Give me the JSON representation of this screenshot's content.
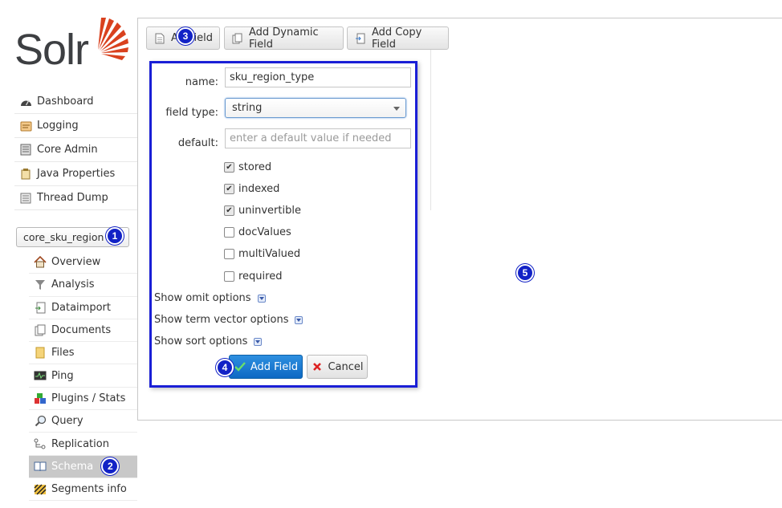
{
  "app": {
    "logo_text": "Solr",
    "brand_color": "#d9411e",
    "annotation_color": "#1222c6"
  },
  "sidebar": {
    "items": [
      {
        "label": "Dashboard",
        "icon": "dashboard-icon"
      },
      {
        "label": "Logging",
        "icon": "logging-icon"
      },
      {
        "label": "Core Admin",
        "icon": "core-admin-icon"
      },
      {
        "label": "Java Properties",
        "icon": "java-properties-icon"
      },
      {
        "label": "Thread Dump",
        "icon": "thread-dump-icon"
      }
    ],
    "core_selector": {
      "value": "core_sku_region",
      "badge": "1"
    },
    "core_items": [
      {
        "label": "Overview",
        "icon": "home-icon"
      },
      {
        "label": "Analysis",
        "icon": "funnel-icon"
      },
      {
        "label": "Dataimport",
        "icon": "import-icon"
      },
      {
        "label": "Documents",
        "icon": "documents-icon"
      },
      {
        "label": "Files",
        "icon": "folder-icon"
      },
      {
        "label": "Ping",
        "icon": "ping-icon"
      },
      {
        "label": "Plugins / Stats",
        "icon": "plugins-icon"
      },
      {
        "label": "Query",
        "icon": "magnifier-icon"
      },
      {
        "label": "Replication",
        "icon": "replication-icon"
      },
      {
        "label": "Schema",
        "icon": "book-icon",
        "active": true,
        "badge": "2"
      },
      {
        "label": "Segments info",
        "icon": "segments-icon"
      }
    ]
  },
  "toolbar": {
    "add_field": {
      "label": "Add Field",
      "label_visible_prefix": "A",
      "label_visible_suffix": "ield",
      "badge": "3"
    },
    "add_dynamic_field": "Add Dynamic Field",
    "add_copy_field": "Add Copy Field"
  },
  "form": {
    "name_label": "name:",
    "name_value": "sku_region_type",
    "field_type_label": "field type:",
    "field_type_value": "string",
    "default_label": "default:",
    "default_placeholder": "enter a default value if needed",
    "checkboxes": [
      {
        "label": "stored",
        "checked": true
      },
      {
        "label": "indexed",
        "checked": true
      },
      {
        "label": "uninvertible",
        "checked": true
      },
      {
        "label": "docValues",
        "checked": false
      },
      {
        "label": "multiValued",
        "checked": false
      },
      {
        "label": "required",
        "checked": false
      }
    ],
    "show_omit": "Show omit options",
    "show_term_vector": "Show term vector options",
    "show_sort": "Show sort options",
    "submit_label": "Add Field",
    "submit_badge": "4",
    "cancel_label": "Cancel"
  },
  "main_badge": "5"
}
